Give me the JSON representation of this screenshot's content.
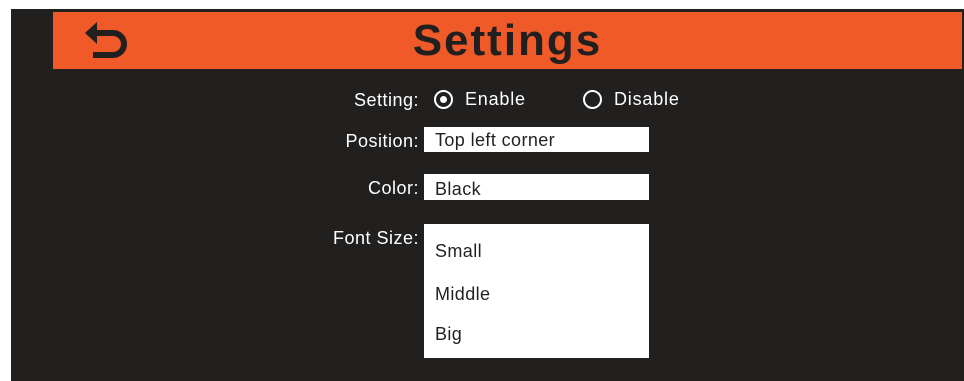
{
  "header": {
    "title": "Settings",
    "back_icon": "back-arrow-icon"
  },
  "setting": {
    "label": "Setting:",
    "options": [
      {
        "label": "Enable",
        "selected": true
      },
      {
        "label": "Disable",
        "selected": false
      }
    ]
  },
  "position": {
    "label": "Position:",
    "value": "Top left corner"
  },
  "color": {
    "label": "Color:",
    "value": "Black"
  },
  "font_size": {
    "label": "Font Size:",
    "options": [
      "Small",
      "Middle",
      "Big"
    ]
  },
  "colors": {
    "header_bg": "#ef5a28",
    "screen_bg": "#221f1f",
    "text": "#ffffff",
    "field_bg": "#ffffff"
  }
}
